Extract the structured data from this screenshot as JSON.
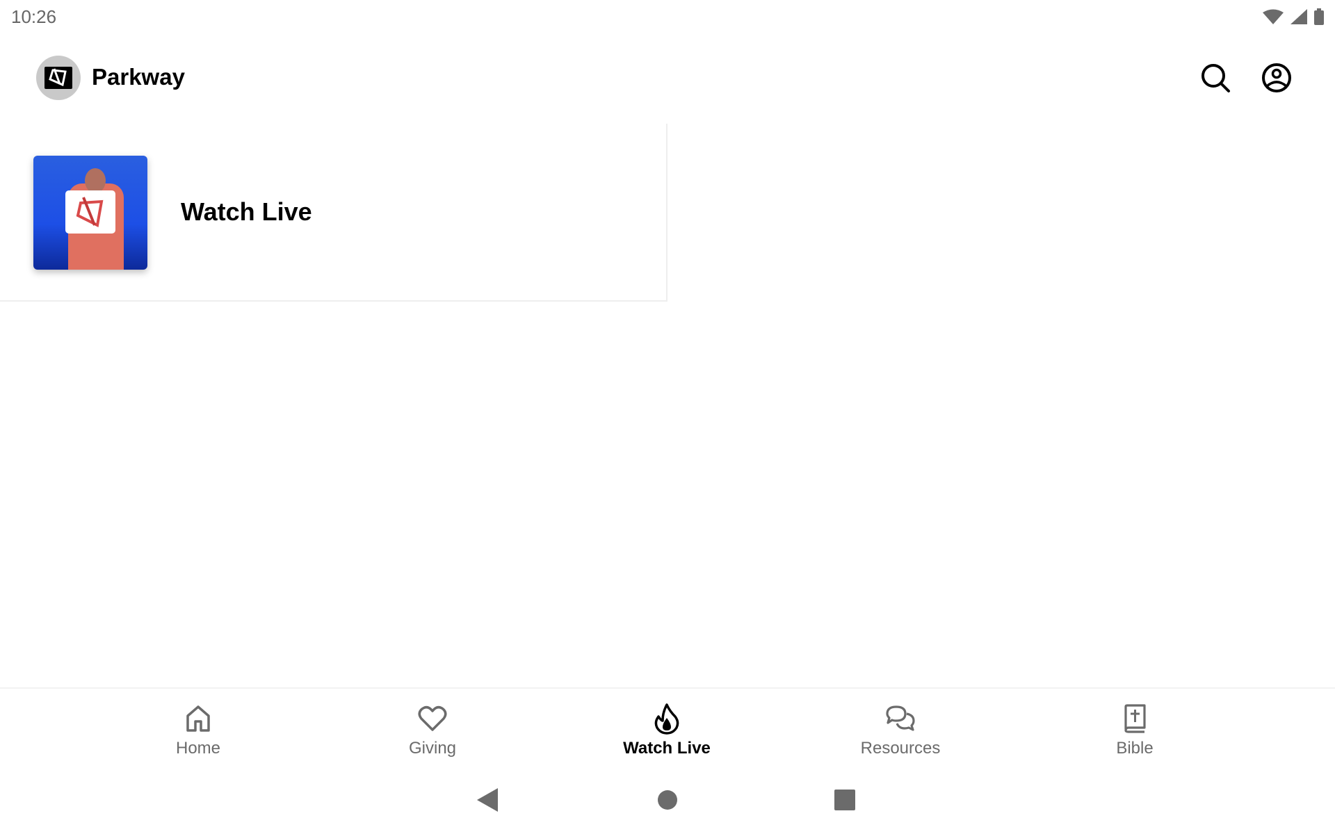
{
  "status_bar": {
    "time": "10:26",
    "icons": [
      "wifi-icon",
      "signal-icon",
      "battery-icon"
    ]
  },
  "app_bar": {
    "title": "Parkway",
    "logo": "parkway-logo",
    "actions": [
      "search-icon",
      "account-icon"
    ]
  },
  "content": {
    "cards": [
      {
        "title": "Watch Live",
        "thumbnail": "watch-live-thumbnail"
      }
    ]
  },
  "bottom_nav": {
    "items": [
      {
        "label": "Home",
        "icon": "home-icon",
        "active": false
      },
      {
        "label": "Giving",
        "icon": "heart-icon",
        "active": false
      },
      {
        "label": "Watch Live",
        "icon": "flame-icon",
        "active": true
      },
      {
        "label": "Resources",
        "icon": "chat-bubbles-icon",
        "active": false
      },
      {
        "label": "Bible",
        "icon": "bible-icon",
        "active": false
      }
    ]
  },
  "system_nav": [
    "back-button",
    "home-button",
    "recents-button"
  ],
  "colors": {
    "active": "#000000",
    "inactive": "#6b6b6b",
    "divider": "#eeeeee"
  }
}
